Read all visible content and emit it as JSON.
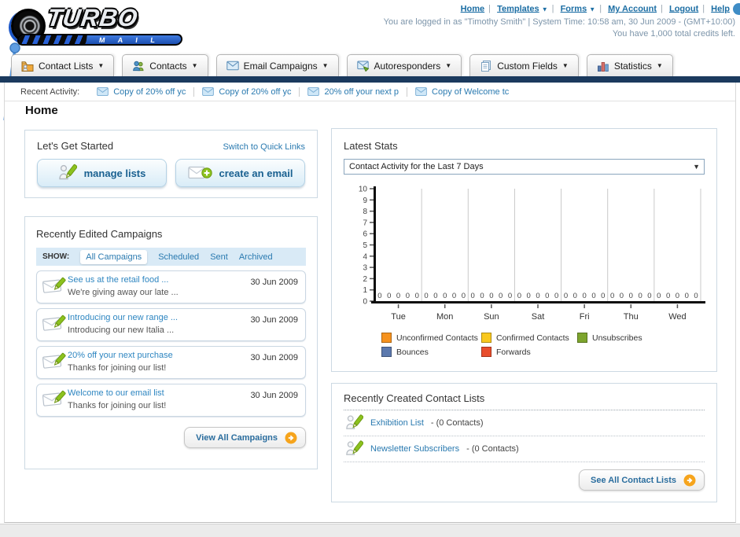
{
  "header": {
    "logo": {
      "title": "TURBO",
      "subtitle": "E M A I L"
    },
    "links": [
      {
        "label": "Home",
        "dropdown": false
      },
      {
        "label": "Templates",
        "dropdown": true
      },
      {
        "label": "Forms",
        "dropdown": true
      },
      {
        "label": "My Account",
        "dropdown": false
      },
      {
        "label": "Logout",
        "dropdown": false
      },
      {
        "label": "Help",
        "dropdown": false
      }
    ],
    "login_line": "You are logged in as \"Timothy Smith\" | System Time: 10:58 am, 30 Jun 2009 - (GMT+10:00)",
    "credits_line": "You have 1,000 total credits left."
  },
  "nav": {
    "tabs": [
      {
        "label": "Contact Lists",
        "icon": "contact-lists-icon"
      },
      {
        "label": "Contacts",
        "icon": "contacts-icon"
      },
      {
        "label": "Email Campaigns",
        "icon": "email-campaigns-icon"
      },
      {
        "label": "Autoresponders",
        "icon": "autoresponders-icon"
      },
      {
        "label": "Custom Fields",
        "icon": "custom-fields-icon"
      },
      {
        "label": "Statistics",
        "icon": "statistics-icon"
      }
    ]
  },
  "recent_activity": {
    "label": "Recent Activity:",
    "items": [
      "Copy of 20% off yc",
      "Copy of 20% off yc",
      "20% off your next p",
      "Copy of Welcome tc"
    ]
  },
  "page": {
    "title": "Home"
  },
  "get_started": {
    "title": "Let's Get Started",
    "switch_link": "Switch to Quick Links",
    "buttons": [
      {
        "label": "manage lists"
      },
      {
        "label": "create an email"
      }
    ]
  },
  "campaigns": {
    "title": "Recently Edited Campaigns",
    "show_label": "SHOW:",
    "filters": [
      "All Campaigns",
      "Scheduled",
      "Sent",
      "Archived"
    ],
    "active_filter": "All Campaigns",
    "items": [
      {
        "title": "See us at the retail food ...",
        "subtitle": "We're giving away our late ...",
        "date": "30 Jun 2009"
      },
      {
        "title": "Introducing our new range ...",
        "subtitle": "Introducing our new Italia ...",
        "date": "30 Jun 2009"
      },
      {
        "title": "20% off your next purchase",
        "subtitle": "Thanks for joining our list!",
        "date": "30 Jun 2009"
      },
      {
        "title": "Welcome to our email list",
        "subtitle": "Thanks for joining our list!",
        "date": "30 Jun 2009"
      }
    ],
    "view_all_label": "View All Campaigns"
  },
  "stats": {
    "title": "Latest Stats",
    "dropdown_value": "Contact Activity for the Last 7 Days",
    "chart_data": {
      "type": "bar",
      "categories": [
        "Tue",
        "Mon",
        "Sun",
        "Sat",
        "Fri",
        "Thu",
        "Wed"
      ],
      "series": [
        {
          "name": "Unconfirmed Contacts",
          "color": "#F6921E",
          "values": [
            0,
            0,
            0,
            0,
            0,
            0,
            0
          ]
        },
        {
          "name": "Confirmed Contacts",
          "color": "#F9C81E",
          "values": [
            0,
            0,
            0,
            0,
            0,
            0,
            0
          ]
        },
        {
          "name": "Unsubscribes",
          "color": "#7DA52D",
          "values": [
            0,
            0,
            0,
            0,
            0,
            0,
            0
          ]
        },
        {
          "name": "Bounces",
          "color": "#5C79AE",
          "values": [
            0,
            0,
            0,
            0,
            0,
            0,
            0
          ]
        },
        {
          "name": "Forwards",
          "color": "#E84D2C",
          "values": [
            0,
            0,
            0,
            0,
            0,
            0,
            0
          ]
        }
      ],
      "ylim": [
        0,
        10
      ],
      "yticks": [
        0,
        1,
        2,
        3,
        4,
        5,
        6,
        7,
        8,
        9,
        10
      ],
      "grid": "vertical",
      "legend_position": "bottom"
    }
  },
  "contact_lists": {
    "title": "Recently Created Contact Lists",
    "items": [
      {
        "name": "Exhibition List",
        "detail": "- (0 Contacts)"
      },
      {
        "name": "Newsletter Subscribers",
        "detail": "- (0 Contacts)"
      }
    ],
    "see_all_label": "See All Contact Lists"
  }
}
